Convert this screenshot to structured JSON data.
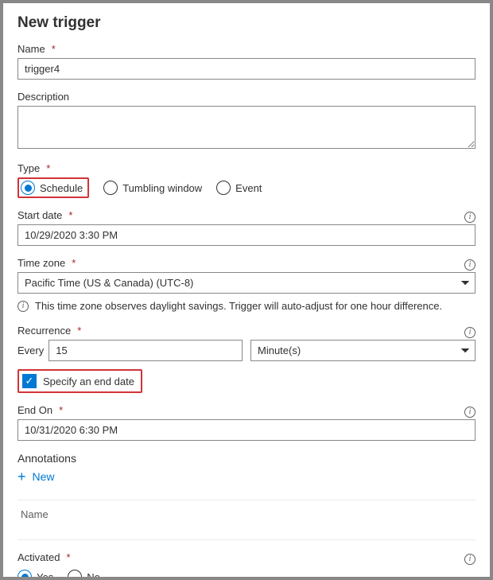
{
  "panel": {
    "title": "New trigger"
  },
  "labels": {
    "name": "Name",
    "description": "Description",
    "type": "Type",
    "start_date": "Start date",
    "time_zone": "Time zone",
    "recurrence": "Recurrence",
    "every": "Every",
    "specify_end": "Specify an end date",
    "end_on": "End On",
    "annotations": "Annotations",
    "new": "New",
    "ann_col_name": "Name",
    "activated": "Activated"
  },
  "values": {
    "name": "trigger4",
    "description": "",
    "start_date": "10/29/2020 3:30 PM",
    "time_zone": "Pacific Time (US & Canada) (UTC-8)",
    "recurrence_value": "15",
    "recurrence_unit": "Minute(s)",
    "end_on": "10/31/2020 6:30 PM",
    "specify_end_checked": true
  },
  "type_options": {
    "schedule": "Schedule",
    "tumbling": "Tumbling window",
    "event": "Event",
    "selected": "schedule"
  },
  "activated_options": {
    "yes": "Yes",
    "no": "No",
    "selected": "yes"
  },
  "messages": {
    "dst": "This time zone observes daylight savings. Trigger will auto-adjust for one hour difference."
  }
}
